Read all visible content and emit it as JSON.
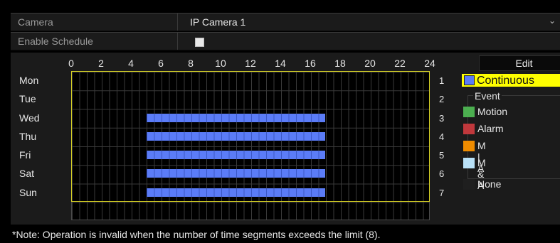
{
  "camera": {
    "label": "Camera",
    "value": "IP Camera 1",
    "arrow_icon": "chevron-down-icon"
  },
  "enable_schedule": {
    "label": "Enable Schedule",
    "checked": false
  },
  "schedule": {
    "hour_labels": [
      "0",
      "2",
      "4",
      "6",
      "8",
      "10",
      "12",
      "14",
      "16",
      "18",
      "20",
      "22",
      "24"
    ],
    "days": [
      {
        "name": "Mon",
        "number": "1",
        "segments": []
      },
      {
        "name": "Tue",
        "number": "2",
        "segments": []
      },
      {
        "name": "Wed",
        "number": "3",
        "segments": [
          {
            "start": 5,
            "end": 17,
            "type": "Continuous"
          }
        ]
      },
      {
        "name": "Thu",
        "number": "4",
        "segments": [
          {
            "start": 5,
            "end": 17,
            "type": "Continuous"
          }
        ]
      },
      {
        "name": "Fri",
        "number": "5",
        "segments": [
          {
            "start": 5,
            "end": 17,
            "type": "Continuous"
          }
        ]
      },
      {
        "name": "Sat",
        "number": "6",
        "segments": [
          {
            "start": 5,
            "end": 17,
            "type": "Continuous"
          }
        ]
      },
      {
        "name": "Sun",
        "number": "7",
        "segments": [
          {
            "start": 5,
            "end": 17,
            "type": "Continuous"
          }
        ]
      }
    ]
  },
  "edit_button": {
    "label": "Edit"
  },
  "legend": {
    "continuous": {
      "label": "Continuous",
      "color": "#5b7cf7",
      "selected": true
    },
    "event_title": "Event",
    "items": [
      {
        "label": "Motion",
        "color": "#4caf50"
      },
      {
        "label": "Alarm",
        "color": "#c0383c"
      },
      {
        "label": "M | A",
        "color": "#ef8c00"
      },
      {
        "label": "M & A",
        "color": "#b9e1f7"
      },
      {
        "label": "None",
        "color": "#1f1f1f"
      }
    ]
  },
  "note": "*Note: Operation is invalid when the number of time segments exceeds the limit (8)."
}
